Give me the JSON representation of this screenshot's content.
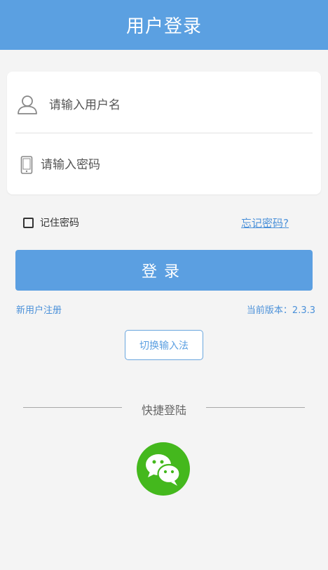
{
  "header": {
    "title": "用户登录"
  },
  "login_form": {
    "username_placeholder": "请输入用户名",
    "username_value": "",
    "password_placeholder": "请输入密码",
    "password_value": "",
    "user_icon": "user-icon",
    "phone_icon": "phone-icon"
  },
  "options": {
    "remember_label": "记住密码",
    "remember_checked": false,
    "forgot_label": "忘记密码?"
  },
  "login_button": {
    "label": "登录"
  },
  "footer_links": {
    "register_label": "新用户注册",
    "version_text": "当前版本：2.3.3"
  },
  "switch_ime": {
    "label": "切换输入法"
  },
  "quick_login": {
    "title": "快捷登陆",
    "wechat_icon": "wechat-icon"
  },
  "colors": {
    "primary": "#5ba0e1",
    "link": "#4a90d9",
    "wechat_green": "#44b81d",
    "background": "#f4f4f4"
  }
}
